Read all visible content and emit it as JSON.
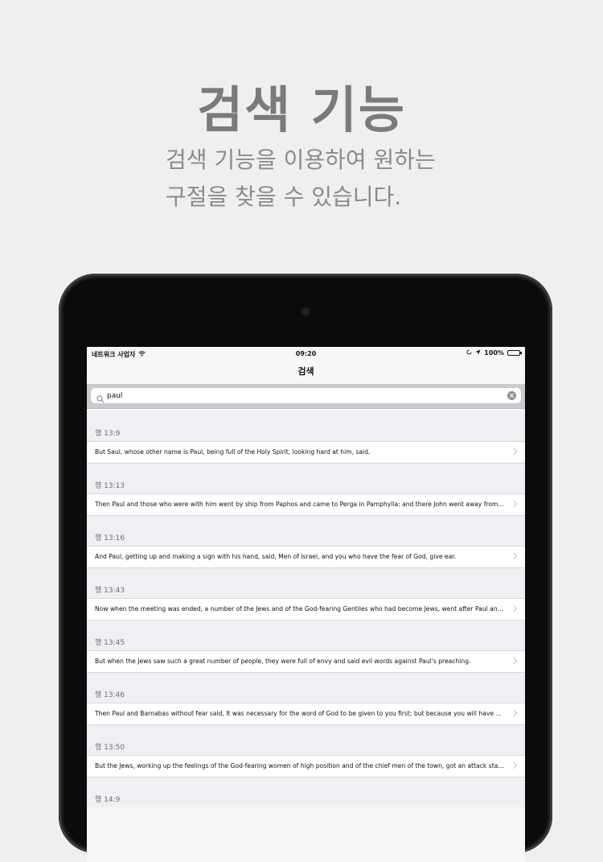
{
  "promo": {
    "headline": "검색 기능",
    "subline_1": "검색 기능을 이용하여 원하는",
    "subline_2": "구절을 찾을 수 있습니다."
  },
  "status_bar": {
    "carrier": "네트워크 사업자",
    "time": "09:20",
    "battery": "100%"
  },
  "nav": {
    "title": "검색"
  },
  "search": {
    "value": "paul"
  },
  "results": [
    {
      "ref": "행 13:9",
      "text": "But Saul, whose other name is Paul, being full of the Holy Spirit, looking hard at him, said,"
    },
    {
      "ref": "행 13:13",
      "text": "Then Paul and those who were with him went by ship from Paphos and came to Perga in Pamphylia: and there John went away from them"
    },
    {
      "ref": "행 13:16",
      "text": "And Paul, getting up and making a sign with his hand, said, Men of Israel, and you who have the fear of God, give ear."
    },
    {
      "ref": "행 13:43",
      "text": "Now when the meeting was ended, a number of the Jews and of the God-fearing Gentiles who had become Jews, went after Paul and Barnabas"
    },
    {
      "ref": "행 13:45",
      "text": "But when the Jews saw such a great number of people, they were full of envy and said evil words against Paul's preaching."
    },
    {
      "ref": "행 13:46",
      "text": "Then Paul and Barnabas without fear said, It was necessary for the word of God to be given to you first; but because you will have none of it"
    },
    {
      "ref": "행 13:50",
      "text": "But the Jews, working up the feelings of the God-fearing women of high position and of the chief men of the town, got an attack started"
    },
    {
      "ref": "행 14:9",
      "text": ""
    }
  ]
}
